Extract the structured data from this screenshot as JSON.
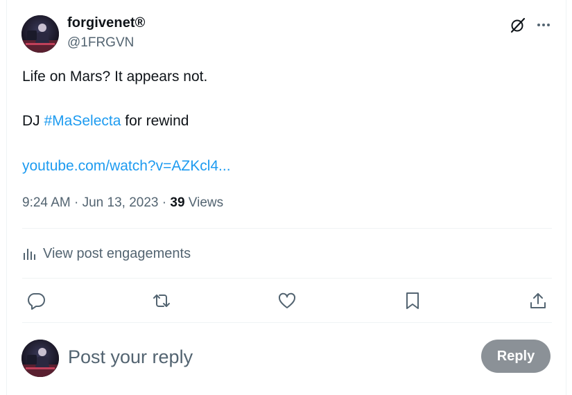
{
  "author": {
    "display_name": "forgivenet®",
    "handle": "@1FRGVN"
  },
  "tweet": {
    "line1": "Life on Mars? It appears not.",
    "line2_prefix": "DJ ",
    "hashtag": "#MaSelecta",
    "line2_suffix": " for rewind",
    "link": "youtube.com/watch?v=AZKcl4..."
  },
  "meta": {
    "time": "9:24 AM",
    "separator1": " · ",
    "date": "Jun 13, 2023",
    "separator2": " · ",
    "views_count": "39",
    "views_label": " Views"
  },
  "engagements_label": "View post engagements",
  "reply_box": {
    "placeholder": "Post your reply",
    "button_label": "Reply"
  },
  "icons": [
    "grok-icon",
    "more-icon",
    "analytics-icon",
    "reply-icon",
    "retweet-icon",
    "like-icon",
    "bookmark-icon",
    "share-icon"
  ],
  "colors": {
    "text": "#0f1419",
    "secondary": "#536471",
    "link": "#1d9bf0",
    "divider": "#eff3f4",
    "reply_button_bg": "#8b9197"
  }
}
